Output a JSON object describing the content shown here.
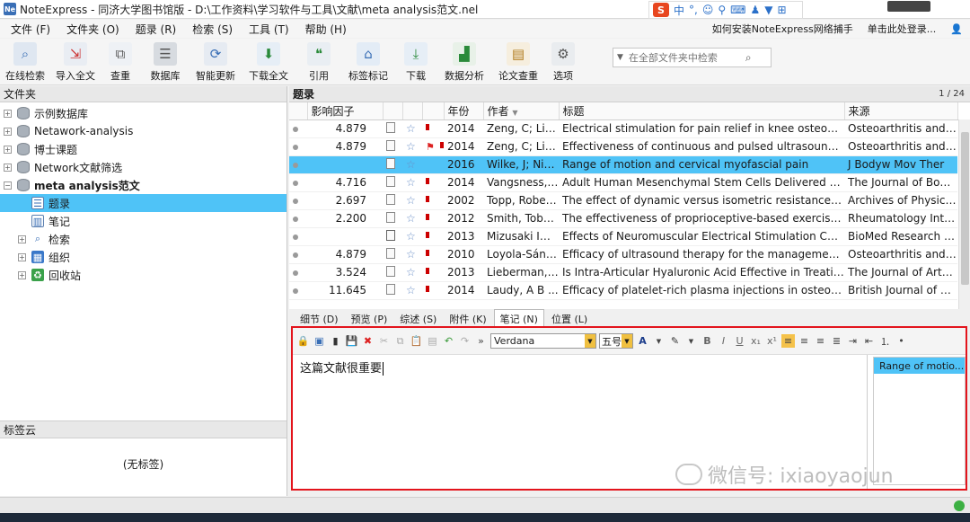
{
  "window": {
    "title": "NoteExpress - 同济大学图书馆版 - D:\\工作资料\\学习软件与工具\\文献\\meta analysis范文.nel",
    "app_icon_text": "Ne"
  },
  "menu": {
    "items": [
      "文件 (F)",
      "文件夹 (O)",
      "题录 (R)",
      "检索 (S)",
      "工具 (T)",
      "帮助 (H)"
    ],
    "right_links": [
      "如何安装NoteExpress网络捕手",
      "单击此处登录..."
    ]
  },
  "toolbar": {
    "buttons": [
      {
        "label": "在线检索",
        "icon": "magnifier-icon"
      },
      {
        "label": "导入全文",
        "icon": "import-icon"
      },
      {
        "label": "查重",
        "icon": "duplicate-icon"
      },
      {
        "label": "数据库",
        "icon": "database-icon"
      },
      {
        "label": "智能更新",
        "icon": "update-icon"
      },
      {
        "label": "下载全文",
        "icon": "download-fulltext-icon"
      },
      {
        "label": "引用",
        "icon": "cite-icon"
      },
      {
        "label": "标签标记",
        "icon": "tag-icon"
      },
      {
        "label": "下载",
        "icon": "download-icon"
      },
      {
        "label": "数据分析",
        "icon": "chart-icon"
      },
      {
        "label": "论文查重",
        "icon": "clipboard-icon"
      },
      {
        "label": "选项",
        "icon": "options-icon"
      }
    ],
    "search_placeholder": "在全部文件夹中检索"
  },
  "sidebar": {
    "header": "文件夹",
    "items": [
      {
        "label": "示例数据库"
      },
      {
        "label": "Netawork-analysis"
      },
      {
        "label": "博士课题"
      },
      {
        "label": "Network文献筛选"
      },
      {
        "label": "meta analysis范文"
      },
      {
        "label": "题录"
      },
      {
        "label": "笔记"
      },
      {
        "label": "检索"
      },
      {
        "label": "组织"
      },
      {
        "label": "回收站"
      }
    ],
    "tag_cloud_header": "标签云",
    "no_tags": "(无标签)"
  },
  "records": {
    "title": "题录",
    "page": "1 / 24",
    "columns": [
      "影响因子",
      "年份",
      "作者",
      "标题",
      "来源"
    ],
    "rows": [
      {
        "if": "4.879",
        "flag": false,
        "year": "2014",
        "author": "Zeng, C; Li, ...",
        "title": "Electrical stimulation for pain relief in knee osteoarthritis:...",
        "source": "Osteoarthritis and C..."
      },
      {
        "if": "4.879",
        "flag": true,
        "year": "2014",
        "author": "Zeng, C; Li, ...",
        "title": "Effectiveness of continuous and pulsed ultrasound for th...",
        "source": "Osteoarthritis and C..."
      },
      {
        "if": "",
        "flag": false,
        "year": "2016",
        "author": "Wilke, J; Nie...",
        "title": "Range of motion and cervical myofascial pain",
        "source": "J Bodyw Mov Ther"
      },
      {
        "if": "4.716",
        "flag": false,
        "year": "2014",
        "author": "Vangsness, ...",
        "title": "Adult Human Mesenchymal Stem Cells Delivered via Intr...",
        "source": "The Journal of Bone ..."
      },
      {
        "if": "2.697",
        "flag": false,
        "year": "2002",
        "author": "Topp, Robert...",
        "title": "The effect of dynamic versus isometric resistance trainin...",
        "source": "Archives of Physical ..."
      },
      {
        "if": "2.200",
        "flag": false,
        "year": "2012",
        "author": "Smith, Toby ...",
        "title": "The effectiveness of proprioceptive-based exercise for o...",
        "source": "Rheumatology Inter..."
      },
      {
        "if": "",
        "flag": false,
        "year": "2013",
        "author": "Mizusaki Im...",
        "title": "Effects of Neuromuscular Electrical Stimulation Combine...",
        "source": "BioMed Research Int..."
      },
      {
        "if": "4.879",
        "flag": false,
        "year": "2010",
        "author": "Loyola-Sánc...",
        "title": "Efficacy of ultrasound therapy for the management of k...",
        "source": "Osteoarthritis and C..."
      },
      {
        "if": "3.524",
        "flag": false,
        "year": "2013",
        "author": "Lieberman, J...",
        "title": "Is Intra-Articular Hyaluronic Acid Effective in Treating Os...",
        "source": "The Journal of Arthr..."
      },
      {
        "if": "11.645",
        "flag": false,
        "year": "2014",
        "author": "Laudy, A B ...",
        "title": "Efficacy of platelet-rich plasma injections in osteoarthriti...",
        "source": "British Journal of Sp..."
      }
    ]
  },
  "tabs": [
    "细节 (D)",
    "预览 (P)",
    "综述 (S)",
    "附件 (K)",
    "笔记 (N)",
    "位置 (L)"
  ],
  "editor": {
    "font": "Verdana",
    "size": "五号",
    "note_text": "这篇文献很重要",
    "linked_record": "Range of motio..."
  },
  "watermark": "微信号: ixiaoyaojun"
}
